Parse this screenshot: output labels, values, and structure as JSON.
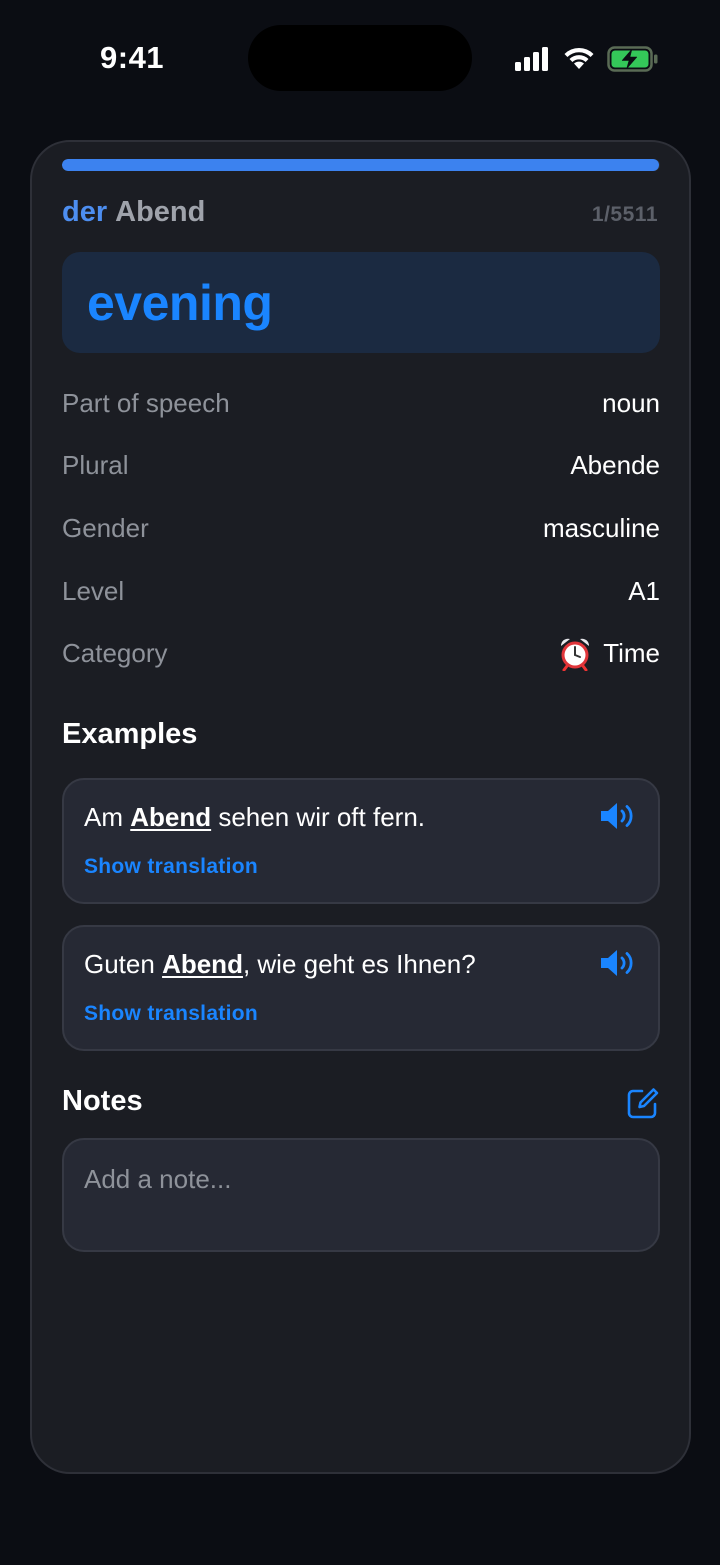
{
  "status_bar": {
    "time": "9:41"
  },
  "card": {
    "progress": 0.998,
    "article": "der",
    "noun": "Abend",
    "counter": "1/5511",
    "translation": "evening",
    "details": [
      {
        "label": "Part of speech",
        "value": "noun"
      },
      {
        "label": "Plural",
        "value": "Abende"
      },
      {
        "label": "Gender",
        "value": "masculine"
      },
      {
        "label": "Level",
        "value": "A1"
      },
      {
        "label": "Category",
        "value": "Time",
        "icon": "alarm-clock-icon"
      }
    ],
    "examples_heading": "Examples",
    "examples": [
      {
        "before": "Am ",
        "highlight": "Abend",
        "after": " sehen wir oft fern.",
        "action": "Show translation"
      },
      {
        "before": "Guten ",
        "highlight": "Abend",
        "after": ", wie geht es Ihnen?",
        "action": "Show translation"
      }
    ],
    "notes_heading": "Notes",
    "notes_placeholder": "Add a note..."
  },
  "colors": {
    "accent": "#1a85ff",
    "article": "#4d8ef0",
    "progress": "#3c82ef",
    "background": "#0b0d13",
    "card": "#1b1d23"
  }
}
